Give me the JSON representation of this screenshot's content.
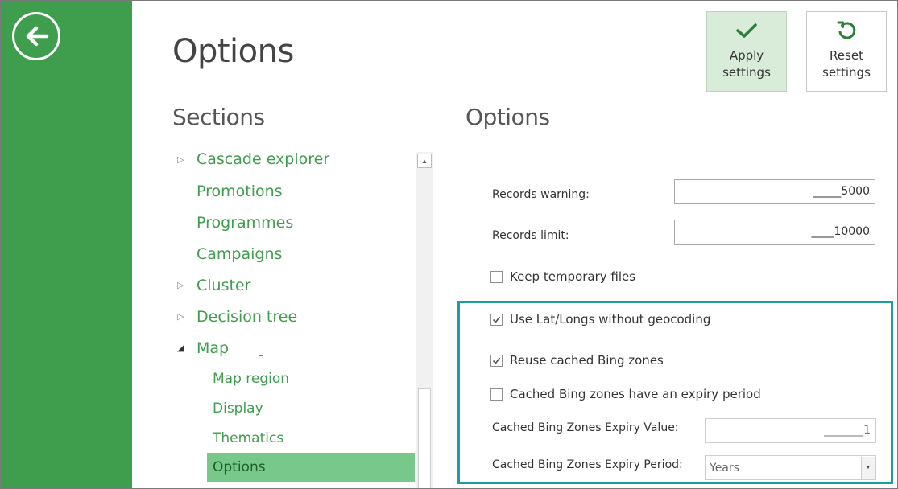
{
  "header": {
    "page_title": "Options"
  },
  "toolbar": {
    "apply_label_line1": "Apply",
    "apply_label_line2": "settings",
    "reset_label_line1": "Reset",
    "reset_label_line2": "settings"
  },
  "sections": {
    "title": "Sections",
    "items": [
      {
        "label": "Cascade explorer",
        "expandable": true,
        "expanded": false
      },
      {
        "label": "Promotions",
        "expandable": false
      },
      {
        "label": "Programmes",
        "expandable": false
      },
      {
        "label": "Campaigns",
        "expandable": false
      },
      {
        "label": "Cluster",
        "expandable": true,
        "expanded": false
      },
      {
        "label": "Decision tree",
        "expandable": true,
        "expanded": false
      },
      {
        "label": "Map",
        "expandable": true,
        "expanded": true
      }
    ],
    "sub_items": [
      {
        "label": "Map region"
      },
      {
        "label": "Display"
      },
      {
        "label": "Thematics"
      },
      {
        "label": "Options",
        "selected": true
      }
    ]
  },
  "options": {
    "title": "Options",
    "records_warning_label": "Records warning:",
    "records_warning_value": "_____5000",
    "records_limit_label": "Records limit:",
    "records_limit_value": "____10000",
    "keep_temp_label": "Keep temporary files",
    "keep_temp_checked": false,
    "use_latlongs_label": "Use Lat/Longs without geocoding",
    "use_latlongs_checked": true,
    "reuse_bing_label": "Reuse cached Bing zones",
    "reuse_bing_checked": true,
    "expiry_period_cb_label": "Cached Bing zones have an expiry period",
    "expiry_period_cb_checked": false,
    "expiry_value_label": "Cached Bing Zones Expiry Value:",
    "expiry_value": "_______1",
    "expiry_period_label": "Cached Bing Zones Expiry Period:",
    "expiry_period_value": "Years"
  },
  "colors": {
    "accent_green": "#3f9e4d",
    "selected_bg": "#79c88b",
    "highlight_border": "#1a9ea0"
  },
  "icons": {
    "back": "back-arrow-circle-icon",
    "apply": "checkmark-icon",
    "reset": "reset-arrow-icon"
  }
}
